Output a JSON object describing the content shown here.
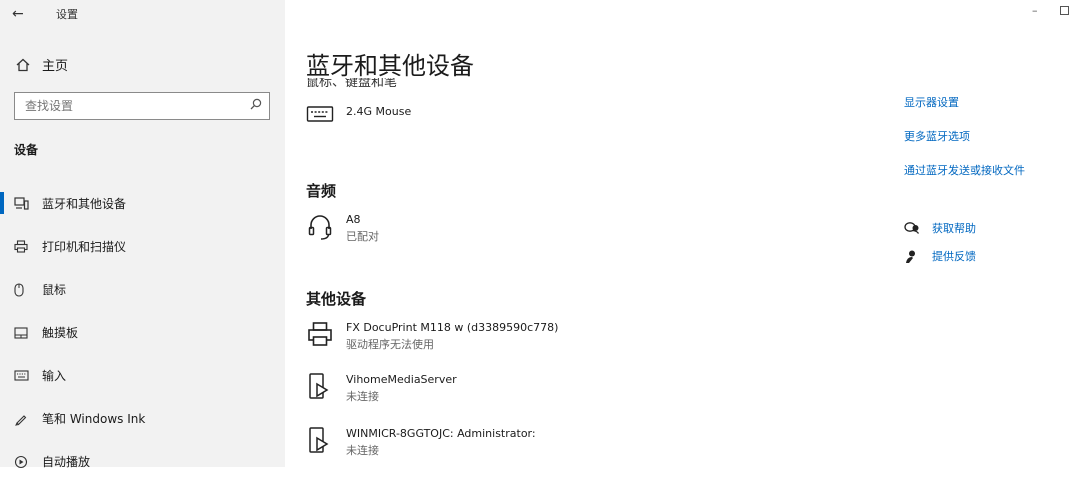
{
  "window": {
    "title": "设置",
    "back_glyph": "←",
    "minimize_glyph": "–"
  },
  "sidebar": {
    "home_label": "主页",
    "search": {
      "placeholder": "查找设置",
      "value": ""
    },
    "section_label": "设备",
    "items": [
      {
        "label": "蓝牙和其他设备",
        "icon": "devices-icon",
        "active": true
      },
      {
        "label": "打印机和扫描仪",
        "icon": "printer-icon",
        "active": false
      },
      {
        "label": "鼠标",
        "icon": "mouse-icon",
        "active": false
      },
      {
        "label": "触摸板",
        "icon": "touchpad-icon",
        "active": false
      },
      {
        "label": "输入",
        "icon": "keyboard-icon",
        "active": false
      },
      {
        "label": "笔和 Windows Ink",
        "icon": "pen-icon",
        "active": false
      },
      {
        "label": "自动播放",
        "icon": "autoplay-icon",
        "active": false
      }
    ]
  },
  "main": {
    "title": "蓝牙和其他设备",
    "cutoff_heading": "鼠标、键盘和笔",
    "mouse_device": {
      "name": "2.4G Mouse",
      "icon": "keyboard-icon"
    },
    "audio": {
      "heading": "音频",
      "devices": [
        {
          "name": "A8",
          "status": "已配对",
          "icon": "headset-icon"
        }
      ]
    },
    "other": {
      "heading": "其他设备",
      "devices": [
        {
          "name": "FX DocuPrint M118 w (d3389590c778)",
          "status": "驱动程序无法使用",
          "icon": "printer-icon"
        },
        {
          "name": "VihomeMediaServer",
          "status": "未连接",
          "icon": "media-device-icon"
        },
        {
          "name": "WINMICR-8GGTOJC: Administrator:",
          "status": "未连接",
          "icon": "media-device-icon"
        }
      ]
    }
  },
  "right_panel": {
    "links": [
      "显示器设置",
      "更多蓝牙选项",
      "通过蓝牙发送或接收文件"
    ],
    "help": [
      {
        "label": "获取帮助",
        "icon": "help-chat-icon"
      },
      {
        "label": "提供反馈",
        "icon": "feedback-icon"
      }
    ]
  }
}
